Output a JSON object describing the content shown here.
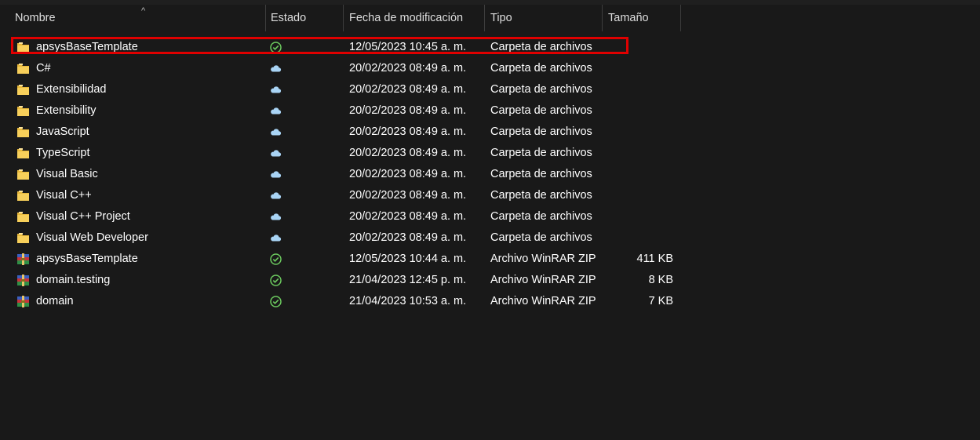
{
  "columns": {
    "name": "Nombre",
    "status": "Estado",
    "modified": "Fecha de modificación",
    "type": "Tipo",
    "size": "Tamaño"
  },
  "sort_indicator": "^",
  "files": [
    {
      "name": "apsysBaseTemplate",
      "status": "synced",
      "date": "12/05/2023 10:45 a. m.",
      "type": "Carpeta de archivos",
      "size": "",
      "icon": "folder-icon"
    },
    {
      "name": "C#",
      "status": "cloud",
      "date": "20/02/2023 08:49 a. m.",
      "type": "Carpeta de archivos",
      "size": "",
      "icon": "folder-icon"
    },
    {
      "name": "Extensibilidad",
      "status": "cloud",
      "date": "20/02/2023 08:49 a. m.",
      "type": "Carpeta de archivos",
      "size": "",
      "icon": "folder-icon"
    },
    {
      "name": "Extensibility",
      "status": "cloud",
      "date": "20/02/2023 08:49 a. m.",
      "type": "Carpeta de archivos",
      "size": "",
      "icon": "folder-icon"
    },
    {
      "name": "JavaScript",
      "status": "cloud",
      "date": "20/02/2023 08:49 a. m.",
      "type": "Carpeta de archivos",
      "size": "",
      "icon": "folder-icon"
    },
    {
      "name": "TypeScript",
      "status": "cloud",
      "date": "20/02/2023 08:49 a. m.",
      "type": "Carpeta de archivos",
      "size": "",
      "icon": "folder-icon"
    },
    {
      "name": "Visual Basic",
      "status": "cloud",
      "date": "20/02/2023 08:49 a. m.",
      "type": "Carpeta de archivos",
      "size": "",
      "icon": "folder-icon"
    },
    {
      "name": "Visual C++",
      "status": "cloud",
      "date": "20/02/2023 08:49 a. m.",
      "type": "Carpeta de archivos",
      "size": "",
      "icon": "folder-icon"
    },
    {
      "name": "Visual C++ Project",
      "status": "cloud",
      "date": "20/02/2023 08:49 a. m.",
      "type": "Carpeta de archivos",
      "size": "",
      "icon": "folder-icon"
    },
    {
      "name": "Visual Web Developer",
      "status": "cloud",
      "date": "20/02/2023 08:49 a. m.",
      "type": "Carpeta de archivos",
      "size": "",
      "icon": "folder-icon"
    },
    {
      "name": "apsysBaseTemplate",
      "status": "synced",
      "date": "12/05/2023 10:44 a. m.",
      "type": "Archivo WinRAR ZIP",
      "size": "411 KB",
      "icon": "winrar-archive-icon"
    },
    {
      "name": "domain.testing",
      "status": "synced",
      "date": "21/04/2023 12:45 p. m.",
      "type": "Archivo WinRAR ZIP",
      "size": "8 KB",
      "icon": "winrar-archive-icon"
    },
    {
      "name": "domain",
      "status": "synced",
      "date": "21/04/2023 10:53 a. m.",
      "type": "Archivo WinRAR ZIP",
      "size": "7 KB",
      "icon": "winrar-archive-icon"
    }
  ],
  "colors": {
    "background": "#191919",
    "highlight": "#e00000",
    "synced": "#6ccb5f",
    "cloud": "#a9d4f5",
    "folder": "#f7cf5a"
  }
}
